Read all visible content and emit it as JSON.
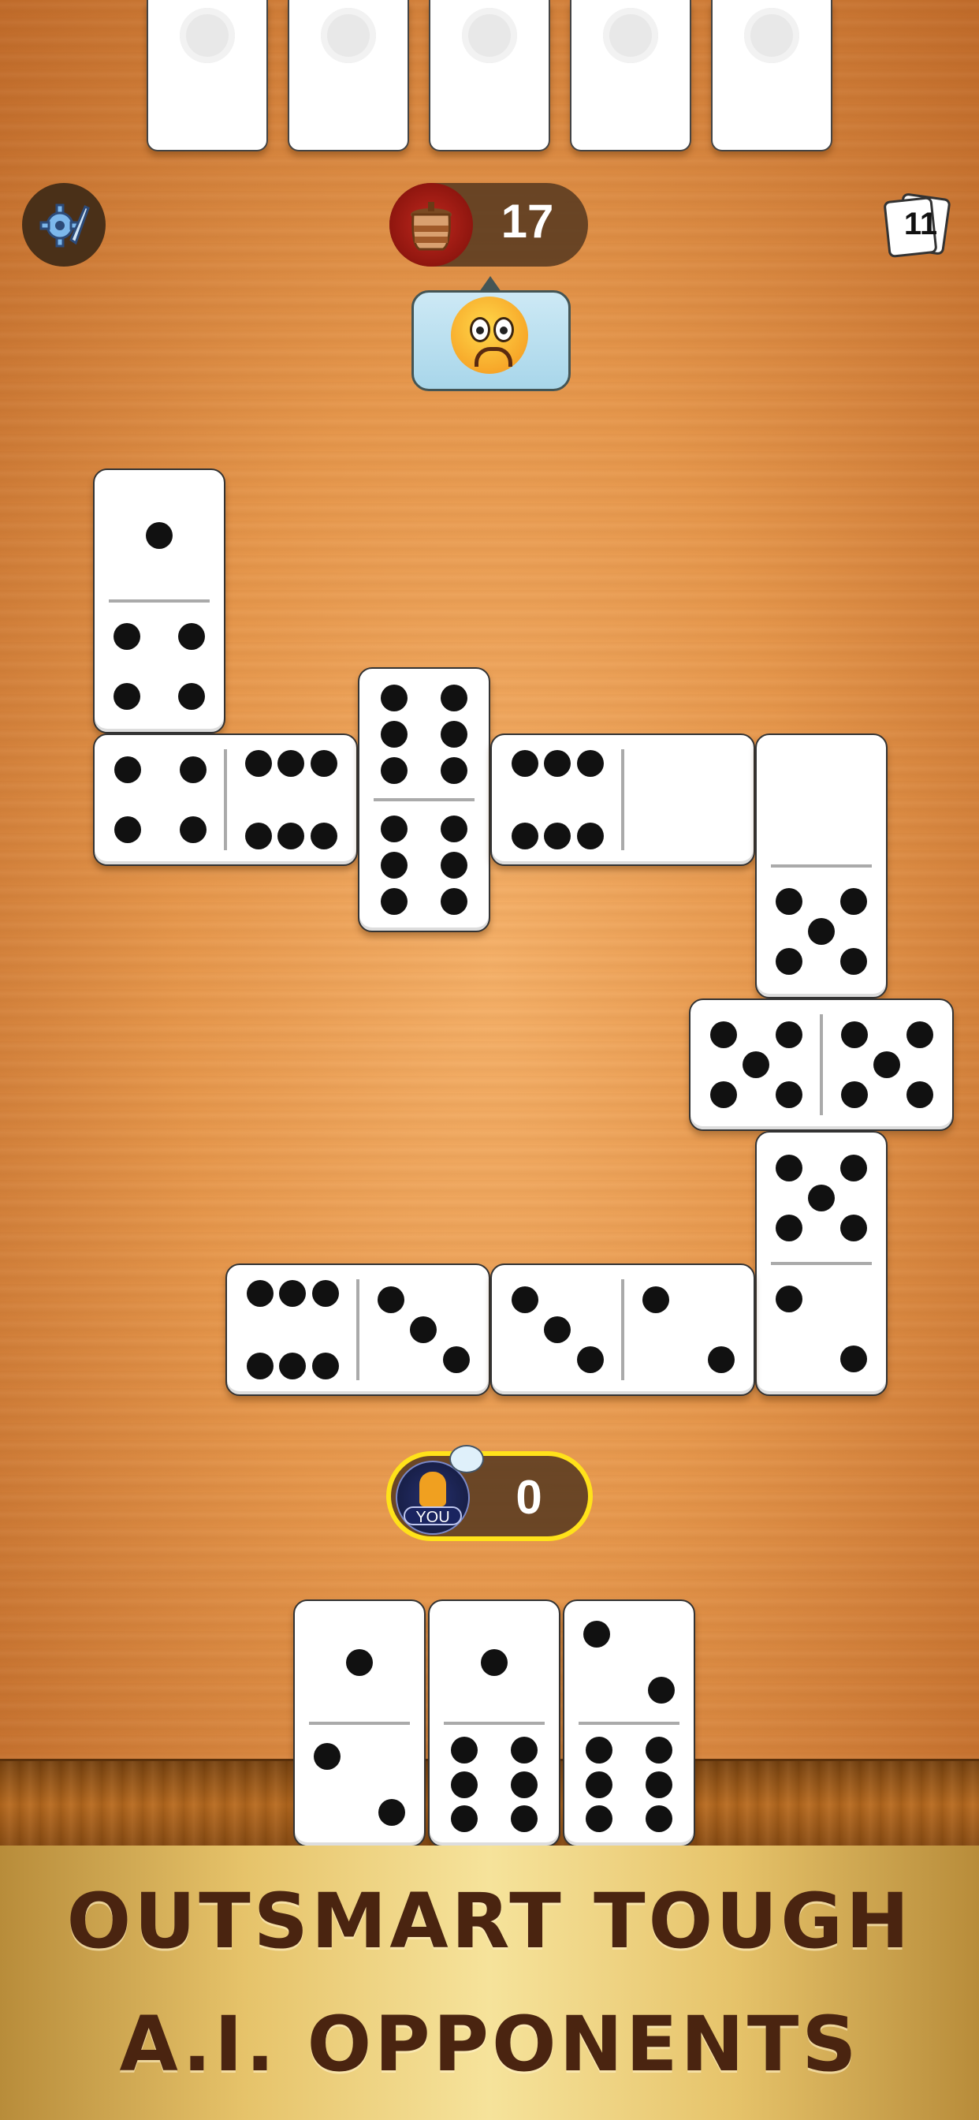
{
  "opponent": {
    "hidden_tiles": 5,
    "score": "17",
    "reaction": "worried-face"
  },
  "boneyard": {
    "count": "11"
  },
  "player": {
    "label": "YOU",
    "score": "0"
  },
  "board": {
    "tiles": [
      {
        "a": 1,
        "b": 4,
        "orientation": "vertical"
      },
      {
        "a": 4,
        "b": 6,
        "orientation": "horizontal"
      },
      {
        "a": 6,
        "b": 6,
        "orientation": "vertical"
      },
      {
        "a": 6,
        "b": 0,
        "orientation": "horizontal"
      },
      {
        "a": 0,
        "b": 5,
        "orientation": "vertical"
      },
      {
        "a": 5,
        "b": 5,
        "orientation": "horizontal"
      },
      {
        "a": 5,
        "b": 2,
        "orientation": "vertical"
      },
      {
        "a": 6,
        "b": 3,
        "orientation": "horizontal"
      },
      {
        "a": 3,
        "b": 2,
        "orientation": "horizontal"
      }
    ]
  },
  "hand": [
    {
      "a": 1,
      "b": 2
    },
    {
      "a": 1,
      "b": 6
    },
    {
      "a": 2,
      "b": 6
    }
  ],
  "banner": {
    "line1": "OUTSMART TOUGH",
    "line2": "A.I. OPPONENTS"
  },
  "colors": {
    "table": "#e6974c",
    "banner_gold": "#e6c36a",
    "banner_text": "#4a2410",
    "player_ring": "#ffe21a"
  }
}
